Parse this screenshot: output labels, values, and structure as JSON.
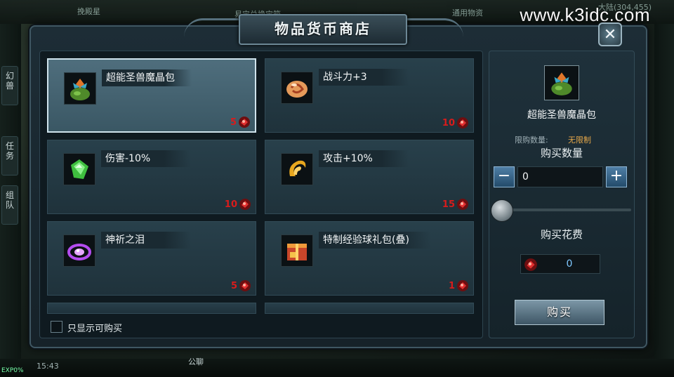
{
  "hud": {
    "top_left": "挽殿星",
    "top_center": "易宝兑换宝箱",
    "top_right": "通用物资",
    "map_coords": "大陆(304,455)",
    "clock": "15:43",
    "exp": "EXP0%",
    "chat": "公聊",
    "side_tabs": [
      "幻兽",
      "任务",
      "组队"
    ]
  },
  "watermark": "www.k3idc.com",
  "shop": {
    "title": "物品货币商店",
    "close_glyph": "✕",
    "items": [
      {
        "name": "超能圣兽魔晶包",
        "price": "5",
        "icon": "beast-crystal-pack-icon",
        "selected": true
      },
      {
        "name": "战斗力+3",
        "price": "10",
        "icon": "combat-stone-icon",
        "selected": false
      },
      {
        "name": "伤害-10%",
        "price": "10",
        "icon": "green-gem-icon",
        "selected": false
      },
      {
        "name": "攻击+10%",
        "price": "15",
        "icon": "golden-swirl-icon",
        "selected": false
      },
      {
        "name": "神祈之泪",
        "price": "5",
        "icon": "purple-tear-icon",
        "selected": false
      },
      {
        "name": "特制经验球礼包(叠)",
        "price": "1",
        "icon": "exp-orb-giftbox-icon",
        "selected": false
      }
    ],
    "filter_label": "只显示可购买",
    "filter_checked": false
  },
  "detail": {
    "item_name": "超能圣兽魔晶包",
    "limit_label": "限购数量:",
    "limit_value": "无限制",
    "qty_title": "购买数量",
    "quantity": "0",
    "minus": "−",
    "plus": "+",
    "slider_fraction": 0,
    "cost_title": "购买花费",
    "cost_value": "0",
    "buy_label": "购买"
  },
  "colors": {
    "price_red": "#d81c1c",
    "limit_orange": "#e6a84a",
    "cost_blue": "#7fc8ff"
  }
}
